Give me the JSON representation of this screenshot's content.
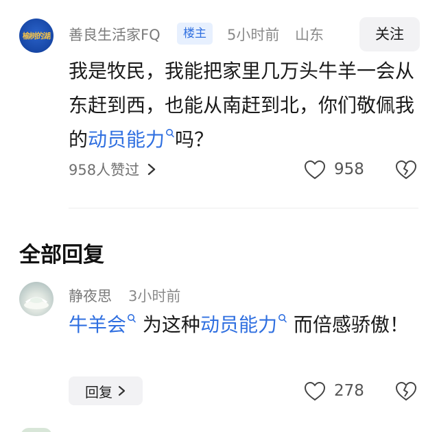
{
  "post": {
    "author": "善良生活家FQ",
    "op_badge": "楼主",
    "time": "5小时前",
    "location": "山东",
    "follow_label": "关注",
    "avatar_text": "榆树的湖",
    "content_prefix": "我是牧民，我能把家里几万头牛羊一会从东赶到西，也能从南赶到北，你们敬佩我的",
    "content_link": "动员能力",
    "content_suffix": "吗？",
    "likers_text": "958人赞过",
    "like_count": "958"
  },
  "replies_section": {
    "title": "全部回复"
  },
  "reply": {
    "author": "静夜思",
    "time": "3小时前",
    "link1": "牛羊会",
    "mid_text": "为这种",
    "link2": "动员能力",
    "suffix": "而倍感骄傲！",
    "reply_label": "回复",
    "like_count": "278"
  },
  "colors": {
    "link": "#2f6fe0",
    "badge_bg": "#e7f0fe",
    "muted_text": "#7a7a7a"
  },
  "icons": [
    "search-mark-icon",
    "chevron-right-icon",
    "heart-outline-icon",
    "broken-heart-icon"
  ]
}
